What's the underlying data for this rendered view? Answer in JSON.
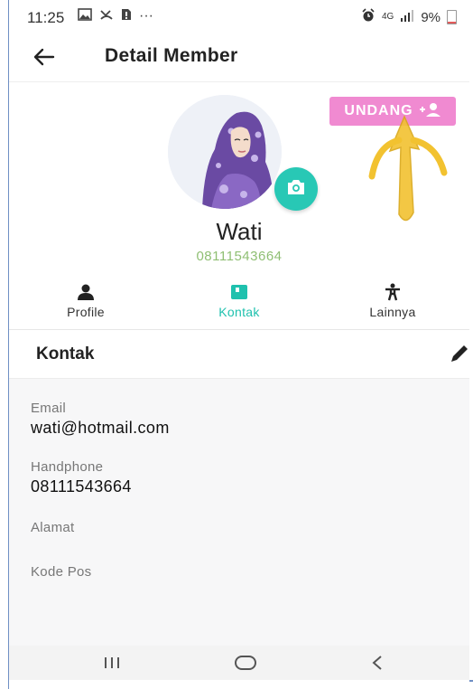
{
  "status": {
    "time": "11:25",
    "more": "···",
    "network": "4G",
    "battery": "9%"
  },
  "appbar": {
    "title": "Detail Member"
  },
  "profile": {
    "invite_label": "UNDANG",
    "name": "Wati",
    "phone": "08111543664"
  },
  "tabs": [
    {
      "label": "Profile",
      "icon": "person-icon",
      "active": false
    },
    {
      "label": "Kontak",
      "icon": "contact-book-icon",
      "active": true
    },
    {
      "label": "Lainnya",
      "icon": "accessibility-icon",
      "active": false
    }
  ],
  "section": {
    "title": "Kontak"
  },
  "fields": [
    {
      "label": "Email",
      "value": "wati@hotmail.com"
    },
    {
      "label": "Handphone",
      "value": "08111543664"
    },
    {
      "label": "Alamat",
      "value": ""
    },
    {
      "label": "Kode Pos",
      "value": ""
    }
  ],
  "colors": {
    "accent": "#1fc1ae",
    "invite": "#f08ad1",
    "phone": "#8fbf73",
    "annotation_arrow": "#f2c230"
  }
}
